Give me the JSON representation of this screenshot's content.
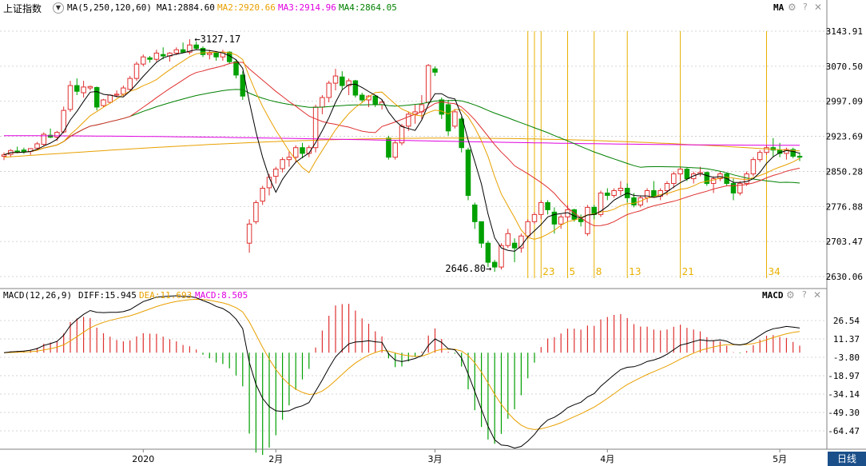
{
  "header": {
    "index_name": "上证指数",
    "ma_settings": "MA(5,250,120,60)",
    "ma_values": [
      {
        "label": "MA1:2884.60",
        "color": "#000000"
      },
      {
        "label": "MA2:2920.66",
        "color": "#e8a000"
      },
      {
        "label": "MA3:2914.96",
        "color": "#e000e0"
      },
      {
        "label": "MA4:2864.05",
        "color": "#008000"
      }
    ],
    "right_label": "MA"
  },
  "macd_header": {
    "settings": "MACD(12,26,9)",
    "values": [
      {
        "label": "DIFF:15.945",
        "color": "#000000"
      },
      {
        "label": "DEA:11.693",
        "color": "#e8a000"
      },
      {
        "label": "MACD:8.505",
        "color": "#e000e0"
      }
    ],
    "right_label": "MACD"
  },
  "footer": {
    "period_tab": "日线"
  },
  "colors": {
    "up": "#e03030",
    "down": "#00a000",
    "grid": "#c8c8c8",
    "vline": "#e8b000",
    "ma5": "#000000",
    "ma10": "#e8a000",
    "ma20": "#e03030",
    "ma60": "#008000",
    "ma120": "#e000e0",
    "ma250": "#e8a000"
  },
  "chart_data": [
    {
      "type": "candlestick",
      "title": "上证指数",
      "y_ticks": [
        "3143.91",
        "3070.50",
        "2997.09",
        "2923.69",
        "2850.28",
        "2776.88",
        "2703.47",
        "2630.06"
      ],
      "ylim": [
        2630.06,
        3143.91
      ],
      "annotations": [
        {
          "text": "3127.17",
          "value": 3127.17
        },
        {
          "text": "2646.80",
          "value": 2646.8
        }
      ],
      "vertical_markers": [
        {
          "label": "23",
          "index": 81
        },
        {
          "label": "5",
          "index": 85
        },
        {
          "label": "8",
          "index": 89
        },
        {
          "label": "13",
          "index": 94
        },
        {
          "label": "21",
          "index": 102
        },
        {
          "label": "34",
          "index": 115
        }
      ],
      "x_labels": [
        {
          "text": "2020",
          "index": 21
        },
        {
          "text": "2月",
          "index": 41
        },
        {
          "text": "3月",
          "index": 65
        },
        {
          "text": "4月",
          "index": 91
        },
        {
          "text": "5月",
          "index": 117
        }
      ],
      "ohlc": [
        [
          2882,
          2890,
          2874,
          2885
        ],
        [
          2886,
          2897,
          2880,
          2894
        ],
        [
          2893,
          2902,
          2888,
          2891
        ],
        [
          2895,
          2900,
          2887,
          2892
        ],
        [
          2892,
          2899,
          2885,
          2898
        ],
        [
          2899,
          2912,
          2895,
          2908
        ],
        [
          2907,
          2932,
          2903,
          2928
        ],
        [
          2926,
          2940,
          2920,
          2922
        ],
        [
          2922,
          2935,
          2914,
          2932
        ],
        [
          2933,
          2986,
          2930,
          2978
        ],
        [
          2980,
          3040,
          2975,
          3030
        ],
        [
          3030,
          3045,
          3010,
          3018
        ],
        [
          3015,
          3040,
          3005,
          3027
        ],
        [
          3025,
          3030,
          3020,
          3028
        ],
        [
          3026,
          3028,
          2978,
          2985
        ],
        [
          2988,
          3002,
          2985,
          3000
        ],
        [
          2995,
          3012,
          2993,
          3010
        ],
        [
          3010,
          3020,
          3005,
          3012
        ],
        [
          3012,
          3030,
          3008,
          3025
        ],
        [
          3022,
          3050,
          3020,
          3045
        ],
        [
          3045,
          3080,
          3040,
          3075
        ],
        [
          3075,
          3095,
          3070,
          3090
        ],
        [
          3088,
          3092,
          3078,
          3085
        ],
        [
          3085,
          3105,
          3080,
          3098
        ],
        [
          3095,
          3110,
          3085,
          3092
        ],
        [
          3092,
          3100,
          3080,
          3098
        ],
        [
          3098,
          3110,
          3094,
          3105
        ],
        [
          3105,
          3120,
          3098,
          3100
        ],
        [
          3100,
          3127,
          3095,
          3115
        ],
        [
          3115,
          3122,
          3105,
          3108
        ],
        [
          3108,
          3112,
          3090,
          3095
        ],
        [
          3095,
          3105,
          3085,
          3098
        ],
        [
          3098,
          3102,
          3082,
          3090
        ],
        [
          3090,
          3105,
          3082,
          3100
        ],
        [
          3100,
          3102,
          3075,
          3080
        ],
        [
          3080,
          3085,
          3045,
          3052
        ],
        [
          3052,
          3060,
          3000,
          3008
        ],
        [
          2700,
          2750,
          2680,
          2740
        ],
        [
          2745,
          2790,
          2740,
          2785
        ],
        [
          2788,
          2820,
          2780,
          2815
        ],
        [
          2816,
          2845,
          2800,
          2838
        ],
        [
          2840,
          2860,
          2825,
          2855
        ],
        [
          2856,
          2880,
          2848,
          2875
        ],
        [
          2875,
          2892,
          2860,
          2880
        ],
        [
          2880,
          2905,
          2870,
          2900
        ],
        [
          2900,
          2910,
          2878,
          2888
        ],
        [
          2888,
          2905,
          2880,
          2900
        ],
        [
          2900,
          2990,
          2890,
          2985
        ],
        [
          2985,
          3010,
          2970,
          3005
        ],
        [
          3005,
          3040,
          2995,
          3035
        ],
        [
          3035,
          3065,
          3020,
          3050
        ],
        [
          3048,
          3060,
          3022,
          3030
        ],
        [
          3030,
          3045,
          3010,
          3040
        ],
        [
          3040,
          3042,
          3005,
          3010
        ],
        [
          3010,
          3015,
          2995,
          3000
        ],
        [
          3000,
          3010,
          2985,
          3008
        ],
        [
          3008,
          3010,
          2985,
          2990
        ],
        [
          2990,
          3000,
          2980,
          2995
        ],
        [
          2920,
          2925,
          2875,
          2880
        ],
        [
          2880,
          2915,
          2875,
          2910
        ],
        [
          2910,
          2950,
          2905,
          2945
        ],
        [
          2945,
          2975,
          2935,
          2970
        ],
        [
          2970,
          2990,
          2950,
          2975
        ],
        [
          2975,
          3010,
          2960,
          2990
        ],
        [
          2995,
          3075,
          2990,
          3072
        ],
        [
          3065,
          3070,
          3050,
          3058
        ],
        [
          3000,
          3005,
          2960,
          2970
        ],
        [
          2990,
          3000,
          2925,
          2935
        ],
        [
          2945,
          2980,
          2940,
          2975
        ],
        [
          2960,
          2965,
          2890,
          2900
        ],
        [
          2895,
          2900,
          2790,
          2800
        ],
        [
          2780,
          2785,
          2730,
          2745
        ],
        [
          2745,
          2745,
          2690,
          2700
        ],
        [
          2700,
          2705,
          2650,
          2660
        ],
        [
          2660,
          2665,
          2640,
          2650
        ],
        [
          2650,
          2700,
          2645,
          2695
        ],
        [
          2695,
          2730,
          2690,
          2720
        ],
        [
          2700,
          2710,
          2660,
          2690
        ],
        [
          2690,
          2720,
          2680,
          2715
        ],
        [
          2715,
          2750,
          2710,
          2745
        ],
        [
          2745,
          2765,
          2740,
          2760
        ],
        [
          2760,
          2790,
          2750,
          2785
        ],
        [
          2785,
          2790,
          2760,
          2770
        ],
        [
          2765,
          2775,
          2720,
          2740
        ],
        [
          2740,
          2760,
          2730,
          2755
        ],
        [
          2755,
          2780,
          2745,
          2770
        ],
        [
          2770,
          2772,
          2745,
          2750
        ],
        [
          2750,
          2760,
          2735,
          2745
        ],
        [
          2720,
          2780,
          2715,
          2775
        ],
        [
          2775,
          2780,
          2750,
          2760
        ],
        [
          2760,
          2810,
          2755,
          2805
        ],
        [
          2805,
          2815,
          2790,
          2800
        ],
        [
          2800,
          2815,
          2795,
          2810
        ],
        [
          2810,
          2830,
          2800,
          2815
        ],
        [
          2815,
          2825,
          2785,
          2795
        ],
        [
          2795,
          2805,
          2775,
          2780
        ],
        [
          2780,
          2800,
          2775,
          2795
        ],
        [
          2795,
          2815,
          2785,
          2810
        ],
        [
          2810,
          2830,
          2795,
          2798
        ],
        [
          2798,
          2815,
          2790,
          2810
        ],
        [
          2810,
          2830,
          2800,
          2825
        ],
        [
          2825,
          2850,
          2815,
          2845
        ],
        [
          2845,
          2860,
          2830,
          2855
        ],
        [
          2855,
          2858,
          2830,
          2835
        ],
        [
          2835,
          2850,
          2825,
          2845
        ],
        [
          2845,
          2860,
          2840,
          2848
        ],
        [
          2848,
          2850,
          2820,
          2825
        ],
        [
          2825,
          2840,
          2805,
          2835
        ],
        [
          2835,
          2850,
          2830,
          2845
        ],
        [
          2845,
          2848,
          2820,
          2825
        ],
        [
          2825,
          2835,
          2790,
          2805
        ],
        [
          2805,
          2830,
          2800,
          2825
        ],
        [
          2825,
          2850,
          2820,
          2845
        ],
        [
          2845,
          2880,
          2840,
          2875
        ],
        [
          2875,
          2895,
          2870,
          2890
        ],
        [
          2890,
          2905,
          2885,
          2900
        ],
        [
          2900,
          2920,
          2880,
          2895
        ],
        [
          2895,
          2910,
          2880,
          2888
        ],
        [
          2888,
          2900,
          2875,
          2896
        ],
        [
          2896,
          2900,
          2878,
          2882
        ],
        [
          2882,
          2890,
          2872,
          2880
        ]
      ]
    },
    {
      "type": "macd",
      "title": "MACD(12,26,9)",
      "series_names": [
        "DIFF",
        "DEA",
        "MACD"
      ],
      "y_ticks": [
        "26.54",
        "11.37",
        "-3.80",
        "-18.97",
        "-34.14",
        "-49.30",
        "-64.47"
      ],
      "ylim": [
        -64.47,
        26.54
      ]
    }
  ]
}
